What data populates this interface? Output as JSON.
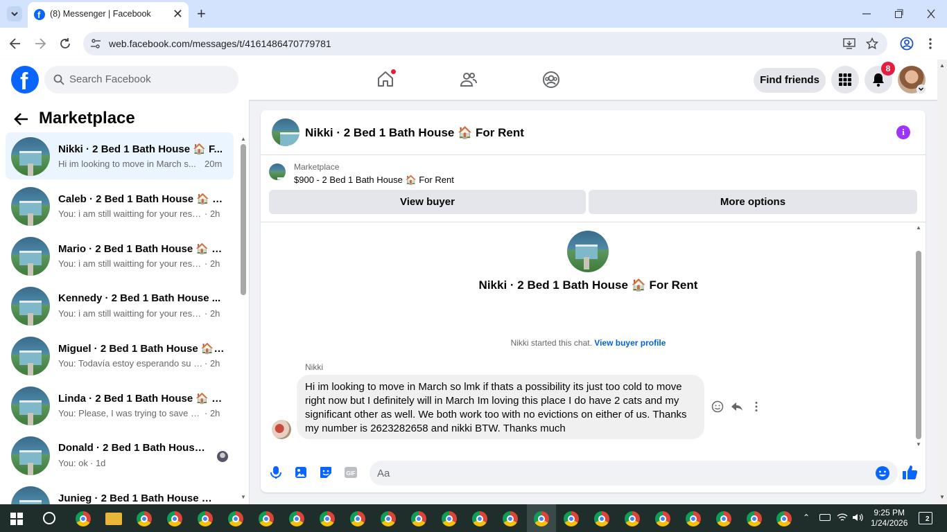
{
  "browser": {
    "tab_title": "(8) Messenger | Facebook",
    "url": "web.facebook.com/messages/t/4161486470779781"
  },
  "header": {
    "search_placeholder": "Search Facebook",
    "find_friends": "Find friends",
    "notification_count": "8"
  },
  "sidebar": {
    "title": "Marketplace",
    "conversations": [
      {
        "name": "Nikki · 2 Bed 1 Bath House 🏠 F...",
        "preview": "Hi im looking to move in March s...",
        "time": "20m"
      },
      {
        "name": "Caleb · 2 Bed 1 Bath House 🏠 F...",
        "preview": "You: i am still waitting for your resp...",
        "time": "· 2h"
      },
      {
        "name": "Mario · 2 Bed 1 Bath House 🏠 F...",
        "preview": "You: i am still waitting for your resp...",
        "time": "· 2h"
      },
      {
        "name": "Kennedy · 2 Bed 1 Bath House ...",
        "preview": "You: i am still waitting for your resp...",
        "time": "· 2h"
      },
      {
        "name": "Miguel · 2 Bed 1 Bath House 🏠 ...",
        "preview": "You: Todavía estoy esperando su re...",
        "time": "· 2h"
      },
      {
        "name": "Linda · 2 Bed 1 Bath House 🏠 F...",
        "preview": "You: Please, I was trying to save you...",
        "time": "· 2h"
      },
      {
        "name": "Donald · 2 Bed 1 Bath House ...",
        "preview": "You: ok",
        "time": "· 1d"
      },
      {
        "name": "Junieg · 2 Bed 1 Bath House 🏠 ...",
        "preview": "",
        "time": ""
      }
    ]
  },
  "chat": {
    "title": "Nikki · 2 Bed 1 Bath House 🏠 For Rent",
    "marketplace_label": "Marketplace",
    "listing": "$900 - 2 Bed 1 Bath House 🏠 For Rent",
    "view_buyer": "View buyer",
    "more_options": "More options",
    "center_title": "Nikki · 2 Bed 1 Bath House 🏠 For Rent",
    "started_text": "Nikki started this chat.",
    "view_buyer_profile": "View buyer profile",
    "sender": "Nikki",
    "message": "Hi im looking to move in March so lmk if thats a possibility its just too cold to move right now but I definitely will in March Im loving this place I do have 2 cats and my significant other as well. We both work too with no evictions on either of us. Thanks my number is 2623282658 and nikki BTW. Thanks much",
    "compose_placeholder": "Aa"
  },
  "taskbar": {
    "time": "9:25 PM",
    "date": "1/24/2026",
    "notifications": "2"
  },
  "colors": {
    "fb_blue": "#0866ff",
    "selected_bg": "#ebf5ff",
    "badge_red": "#e41e3f",
    "info_purple": "#a033ff"
  }
}
